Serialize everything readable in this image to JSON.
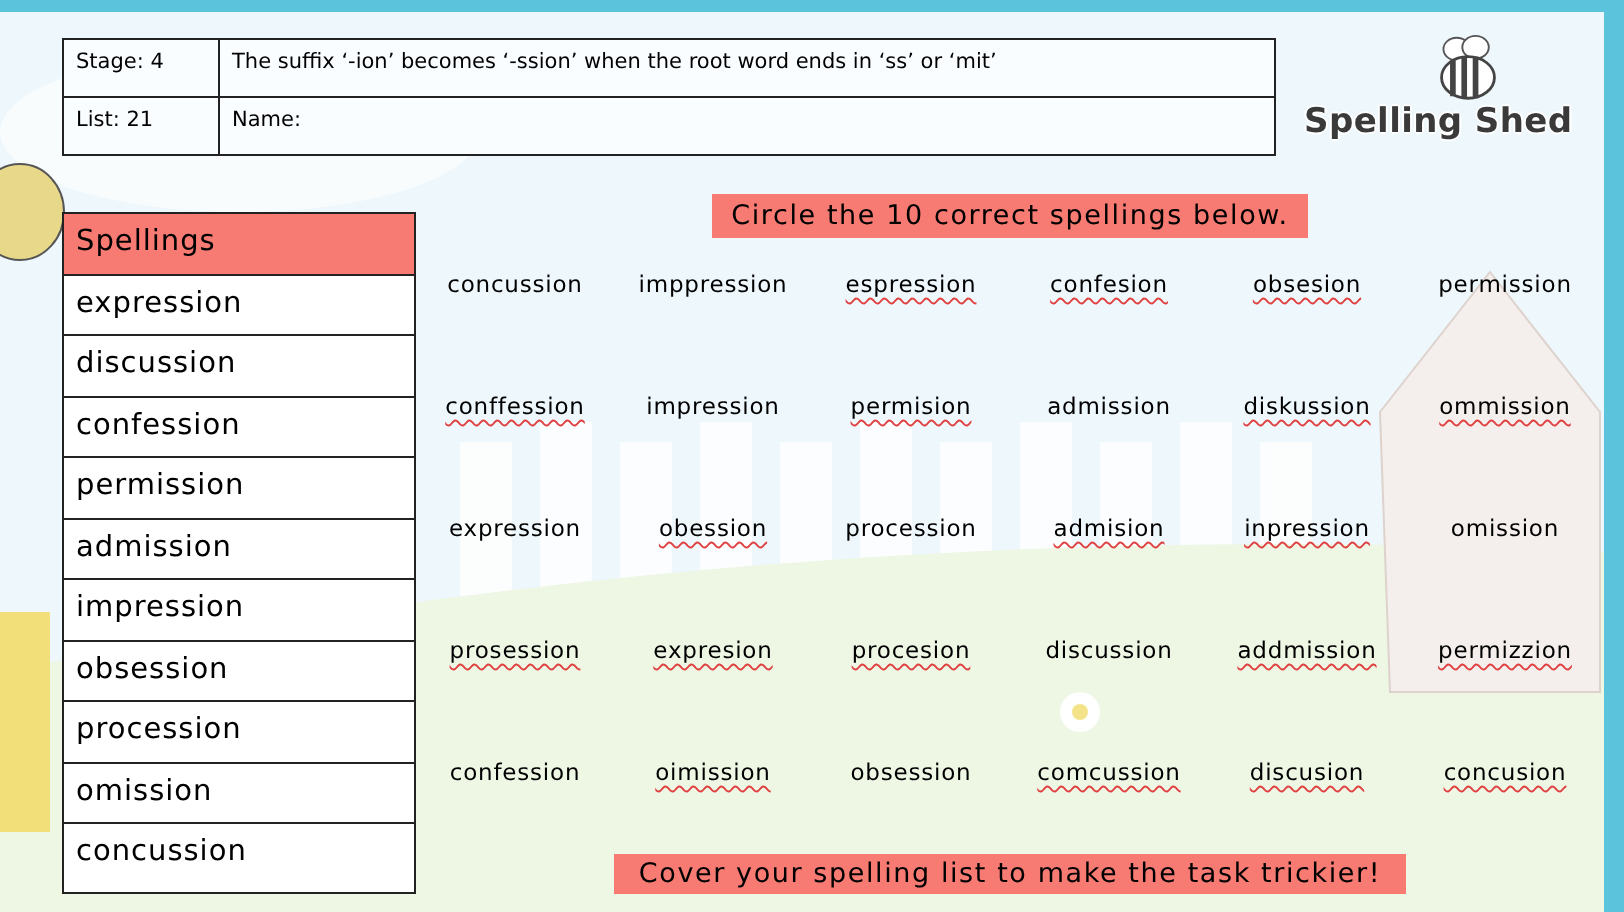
{
  "header": {
    "stage": "Stage: 4",
    "list": "List: 21",
    "rule": "The suffix ‘-ion’ becomes ‘-ssion’ when the root word ends in ‘ss’ or ‘mit’",
    "name_label": "Name:"
  },
  "logo": {
    "text": "Spelling Shed"
  },
  "spellings": {
    "title": "Spellings",
    "words": [
      "expression",
      "discussion",
      "confession",
      "permission",
      "admission",
      "impression",
      "obsession",
      "procession",
      "omission",
      "concussion"
    ]
  },
  "instruction": "Circle the 10 correct spellings below.",
  "grid": [
    [
      {
        "word": "concussion",
        "flagged": false
      },
      {
        "word": "imppression",
        "flagged": false
      },
      {
        "word": "espression",
        "flagged": true
      },
      {
        "word": "confesion",
        "flagged": true
      },
      {
        "word": "obsesion",
        "flagged": true
      },
      {
        "word": "permission",
        "flagged": false
      }
    ],
    [
      {
        "word": "conffession",
        "flagged": true
      },
      {
        "word": "impression",
        "flagged": false
      },
      {
        "word": "permision",
        "flagged": true
      },
      {
        "word": "admission",
        "flagged": false
      },
      {
        "word": "diskussion",
        "flagged": true
      },
      {
        "word": "ommission",
        "flagged": true
      }
    ],
    [
      {
        "word": "expression",
        "flagged": false
      },
      {
        "word": "obession",
        "flagged": true
      },
      {
        "word": "procession",
        "flagged": false
      },
      {
        "word": "admision",
        "flagged": true
      },
      {
        "word": "inpression",
        "flagged": true
      },
      {
        "word": "omission",
        "flagged": false
      }
    ],
    [
      {
        "word": "prosession",
        "flagged": true
      },
      {
        "word": "expresion",
        "flagged": true
      },
      {
        "word": "procesion",
        "flagged": true
      },
      {
        "word": "discussion",
        "flagged": false
      },
      {
        "word": "addmission",
        "flagged": true
      },
      {
        "word": "permizzion",
        "flagged": true
      }
    ],
    [
      {
        "word": "confession",
        "flagged": false
      },
      {
        "word": "oimission",
        "flagged": true
      },
      {
        "word": "obsession",
        "flagged": false
      },
      {
        "word": "comcussion",
        "flagged": true
      },
      {
        "word": "discusion",
        "flagged": true
      },
      {
        "word": "concusion",
        "flagged": true
      }
    ]
  ],
  "tip": "Cover your spelling list to make the task trickier!"
}
